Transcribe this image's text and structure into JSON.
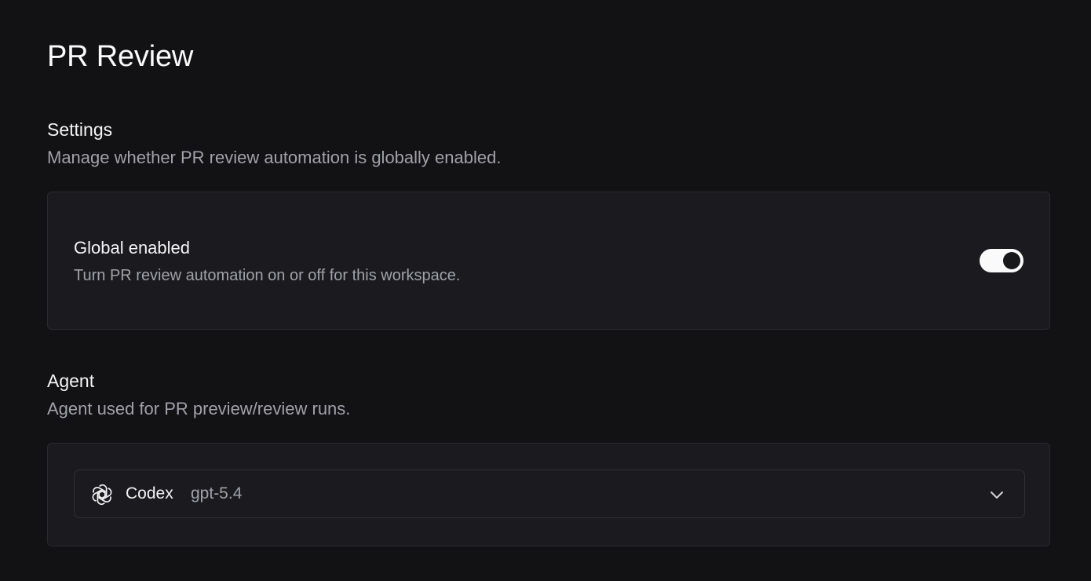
{
  "page": {
    "title": "PR Review"
  },
  "settings": {
    "heading": "Settings",
    "description": "Manage whether PR review automation is globally enabled.",
    "global_enabled": {
      "label": "Global enabled",
      "description": "Turn PR review automation on or off for this workspace.",
      "state": "on"
    }
  },
  "agent": {
    "heading": "Agent",
    "description": "Agent used for PR preview/review runs.",
    "selected": {
      "name": "Codex",
      "model": "gpt-5.4",
      "icon": "openai-icon"
    }
  },
  "colors": {
    "background": "#121214",
    "card": "#1b1b1f",
    "toggle_on": "#fafafa"
  }
}
